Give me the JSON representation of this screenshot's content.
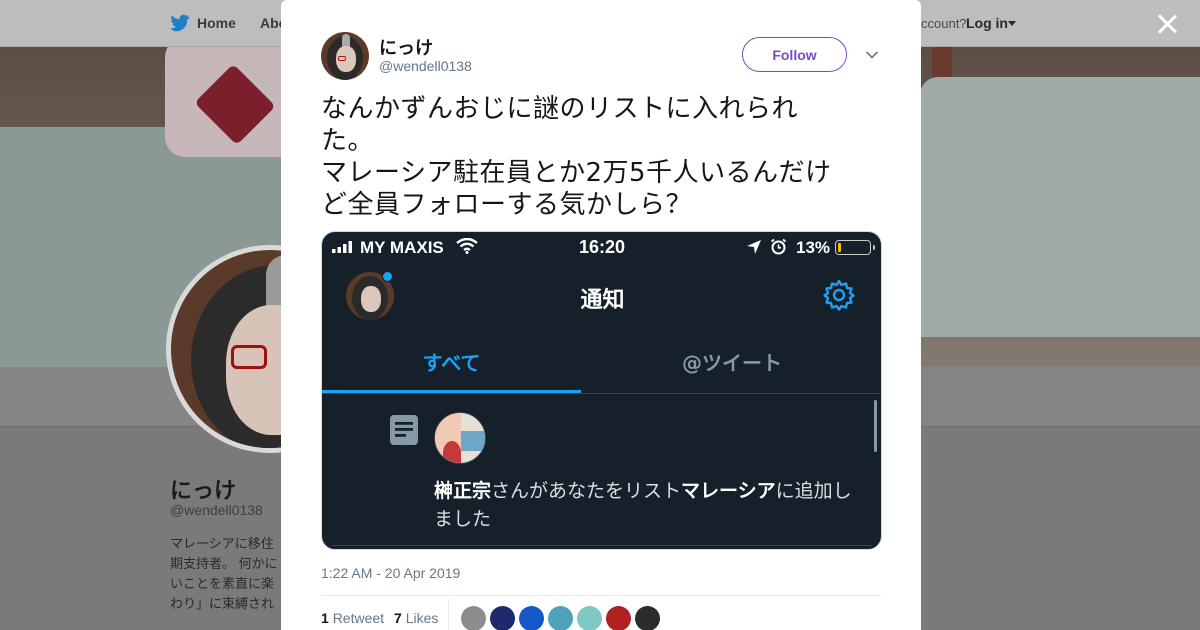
{
  "topnav": {
    "home_label": "Home",
    "about_label": "Abo",
    "account_prompt": "ccount?",
    "login_label": "Log in"
  },
  "profile": {
    "name": "にっけ",
    "handle": "@wendell0138",
    "bio": "マレーシアに移住 期支持者。 何かに いことを素直に楽 わり」に束縛され"
  },
  "tweet": {
    "author_name": "にっけ",
    "author_handle": "@wendell0138",
    "follow_label": "Follow",
    "text": "なんかずんおじに謎のリストに入れられ\nた。\nマレーシア駐在員とか2万5千人いるんだけ\nど全員フォローする気かしら？",
    "timestamp": "1:22 AM - 20 Apr 2019",
    "retweets_count": "1",
    "retweets_label": "Retweet",
    "likes_count": "7",
    "likes_label": "Likes",
    "liker_colors": [
      "#8d8d8d",
      "#1e2a6b",
      "#1458c7",
      "#4fa3b8",
      "#7fc9c4",
      "#b12121",
      "#2b2b2b"
    ]
  },
  "screenshot": {
    "carrier": "MY MAXIS",
    "time": "16:20",
    "battery_percent_label": "13%",
    "battery_level": 0.13,
    "title": "通知",
    "tab_all": "すべて",
    "tab_mentions": "@ツイート",
    "notification_user": "榊正宗",
    "notification_mid": "さんがあなたをリスト",
    "notification_list": "マレーシア",
    "notification_end": "に追加しました"
  },
  "colors": {
    "accent": "#794bc4",
    "twitter_blue": "#1da1f2",
    "dark_bg": "#15202b"
  },
  "icons": {
    "bird": "twitter-bird-icon",
    "close": "close-icon",
    "chevron": "chevron-down-icon",
    "gear": "gear-icon",
    "list": "list-icon"
  }
}
